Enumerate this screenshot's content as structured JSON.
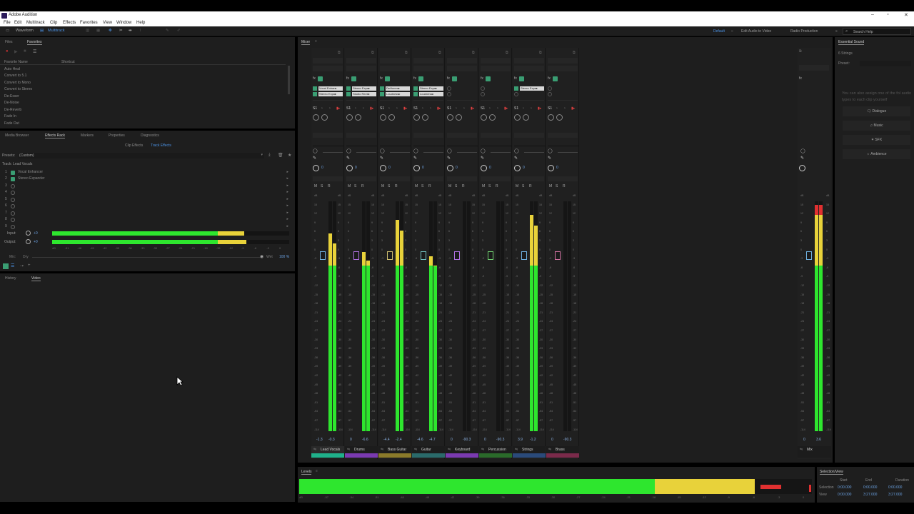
{
  "app": {
    "title": "Adobe Audition"
  },
  "menu": [
    "File",
    "Edit",
    "Multitrack",
    "Clip",
    "Effects",
    "Favorites",
    "View",
    "Window",
    "Help"
  ],
  "toolbar": {
    "waveform": "Waveform",
    "multitrack": "Multitrack"
  },
  "workspaces": {
    "default": "Default",
    "edit_video": "Edit Audio to Video",
    "radio": "Radio Production",
    "search_placeholder": "Search Help"
  },
  "files_panel": {
    "tabs": [
      "Files",
      "Favorites"
    ],
    "col_name": "Favorite Name",
    "col_shortcut": "Shortcut",
    "items": [
      "Auto Heal",
      "Convert to 5.1",
      "Convert to Mono",
      "Convert to Stereo",
      "De-Esser",
      "De-Noise",
      "De-Reverb",
      "Fade In",
      "Fade Out"
    ]
  },
  "effects_panel": {
    "tabs": [
      "Media Browser",
      "Effects Rack",
      "Markers",
      "Properties",
      "Diagnostics"
    ],
    "subtabs": [
      "Clip Effects",
      "Track Effects"
    ],
    "presets_label": "Presets:",
    "preset_value": "(Custom)",
    "track_label": "Track: Lead Vocals",
    "rows": [
      {
        "n": "1",
        "name": "Vocal Enhancer",
        "on": true
      },
      {
        "n": "2",
        "name": "Stereo Expander",
        "on": true
      },
      {
        "n": "3",
        "name": "",
        "on": false
      },
      {
        "n": "4",
        "name": "",
        "on": false
      },
      {
        "n": "5",
        "name": "",
        "on": false
      },
      {
        "n": "6",
        "name": "",
        "on": false
      },
      {
        "n": "7",
        "name": "",
        "on": false
      },
      {
        "n": "8",
        "name": "",
        "on": false
      },
      {
        "n": "9",
        "name": "",
        "on": false
      }
    ],
    "input_label": "Input:",
    "input_value": "+0",
    "output_label": "Output:",
    "output_value": "+0",
    "mix_label": "Mix:",
    "dry_label": "Dry",
    "wet_label": "Wet",
    "wet_value": "100 %",
    "input_level": 0.81,
    "output_level": 0.82,
    "scale": [
      "dB",
      "-51",
      "-48",
      "-45",
      "-42",
      "-39",
      "-36",
      "-33",
      "-30",
      "-27",
      "-24",
      "-21",
      "-18",
      "-15",
      "-12",
      "-9",
      "-6",
      "-3",
      "0"
    ]
  },
  "history_panel": {
    "tabs": [
      "History",
      "Video"
    ]
  },
  "mixer": {
    "title": "Mixer",
    "tracks": [
      {
        "name": "Lead Vocals",
        "fx": [
          "Vocal Enhan▸",
          "Stereo Expa▸"
        ],
        "left": "-1.3",
        "right": "-0.3",
        "level": 0.86,
        "fader_color": "#6fb0e0",
        "color": "#1fb08a",
        "sel": true
      },
      {
        "name": "Drums",
        "fx": [
          "Stereo Expa▸",
          "Studio Reve▸"
        ],
        "left": "0",
        "right": "-6.6",
        "level": 0.78,
        "fader_color": "#b070e0",
        "color": "#7a3ab0",
        "sel": false
      },
      {
        "name": "Bass Guitar",
        "fx": [
          "DeHumm▸",
          "Loudness▸"
        ],
        "left": "-4.4",
        "right": "-2.4",
        "level": 0.92,
        "fader_color": "#d0c070",
        "color": "#8a7a2a",
        "sel": false
      },
      {
        "name": "Guitar",
        "fx": [
          "Stereo Expa▸",
          "Loudness▸"
        ],
        "left": "-4.6",
        "right": "-4.7",
        "level": 0.76,
        "fader_color": "#70c0c0",
        "color": "#2a6a6a",
        "sel": false
      },
      {
        "name": "Keyboard",
        "fx": [],
        "left": "0",
        "right": "-90.3",
        "level": 0.0,
        "fader_color": "#b070e0",
        "color": "#7a3ab0",
        "sel": false
      },
      {
        "name": "Percussion",
        "fx": [],
        "left": "0",
        "right": "-90.3",
        "level": 0.0,
        "fader_color": "#70d070",
        "color": "#2a6a2a",
        "sel": false
      },
      {
        "name": "Strings",
        "fx": [
          "Stereo Expa▸"
        ],
        "left": "3.9",
        "right": "-1.2",
        "level": 0.94,
        "fader_color": "#6fb0e0",
        "color": "#2a4a7a",
        "sel": false
      },
      {
        "name": "Brass",
        "fx": [],
        "left": "0",
        "right": "-90.3",
        "level": 0.0,
        "fader_color": "#d070a0",
        "color": "#7a2a4a",
        "sel": false
      }
    ],
    "master": {
      "name": "Mix",
      "left": "0",
      "right": "3.6",
      "level": 0.94
    },
    "scale": [
      "dB",
      "15",
      "12",
      "9",
      "6",
      "3",
      "0",
      "-3",
      "-6",
      "-9",
      "-12",
      "-15",
      "-18",
      "-21",
      "-24",
      "-27",
      "-30",
      "-33",
      "-36",
      "-39",
      "-42",
      "-45",
      "-48",
      "-51",
      "-54",
      "-57",
      "-114"
    ]
  },
  "essential_sound": {
    "title": "Essential Sound",
    "track": "6 Strings",
    "preset_label": "Preset:",
    "hint": "You can also assign one of the fol audio types to each clip yourself",
    "types": [
      "Dialogue",
      "Music",
      "SFX",
      "Ambience"
    ]
  },
  "levels": {
    "title": "Levels",
    "level": 0.94,
    "scale": [
      "dB",
      "-57",
      "-54",
      "-51",
      "-48",
      "-45",
      "-42",
      "-39",
      "-36",
      "-33",
      "-30",
      "-27",
      "-24",
      "-21",
      "-18",
      "-15",
      "-12",
      "-9",
      "-6",
      "-3",
      "0"
    ]
  },
  "selection_view": {
    "title": "Selection/View",
    "headers": [
      "Start",
      "End",
      "Duration"
    ],
    "rows": [
      {
        "label": "Selection",
        "start": "0:00.000",
        "end": "0:00.000",
        "duration": "0:00.000"
      },
      {
        "label": "View",
        "start": "0:00.000",
        "end": "3:27.000",
        "duration": "3:27.000"
      }
    ]
  }
}
